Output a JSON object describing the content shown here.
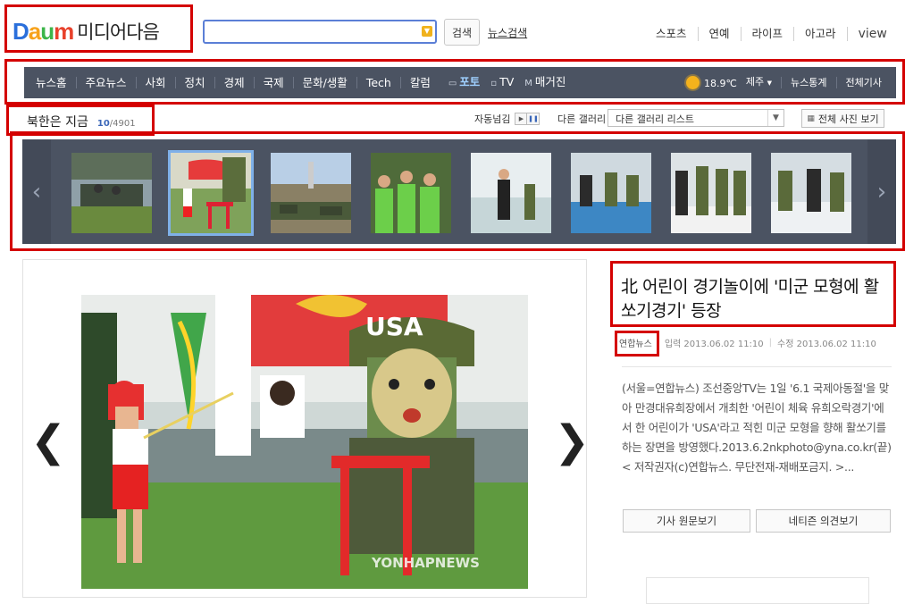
{
  "header": {
    "logo_text": "Daum",
    "brand": "미디어다음",
    "search_placeholder": "",
    "search_button": "검색",
    "news_search": "뉴스검색",
    "top_nav": [
      "스포츠",
      "연예",
      "라이프",
      "아고라",
      "view"
    ]
  },
  "gnb": {
    "items": [
      "뉴스홈",
      "주요뉴스",
      "사회",
      "정치",
      "경제",
      "국제",
      "문화/생활",
      "Tech",
      "칼럼"
    ],
    "photo": "포토",
    "tv": "TV",
    "magazine": "매거진",
    "weather_temp": "18.9℃",
    "weather_city": "제주",
    "stats": "뉴스통계",
    "all_articles": "전체기사"
  },
  "gallery_header": {
    "title": "북한은 지금",
    "current": "10",
    "total": "/4901",
    "auto_label": "자동넘김",
    "other_gallery_label": "다른 갤러리",
    "other_gallery_select": "다른 갤러리 리스트",
    "view_all": "전체 사진 보기"
  },
  "article": {
    "headline": "北 어린이 경기놀이에 '미군 모형에 활쏘기경기' 등장",
    "source": "연합뉴스",
    "input_date": "입력 2013.06.02 11:10",
    "edit_date": "수정 2013.06.02 11:10",
    "body": "(서울=연합뉴스) 조선중앙TV는 1일 '6.1 국제아동절'을 맞아 만경대유희장에서 개최한 '어린이 체육 유희오락경기'에서 한 어린이가 'USA'라고 적힌 미군 모형을 향해 활쏘기를 하는 장면을 방영했다.2013.6.2nkphoto@yna.co.kr(끝)< 저작권자(c)연합뉴스. 무단전재-재배포금지. >...",
    "btn_original": "기사 원문보기",
    "btn_comments": "네티즌 의견보기"
  },
  "image": {
    "sign_text": "USA",
    "watermark": "YONHAPNEWS"
  }
}
